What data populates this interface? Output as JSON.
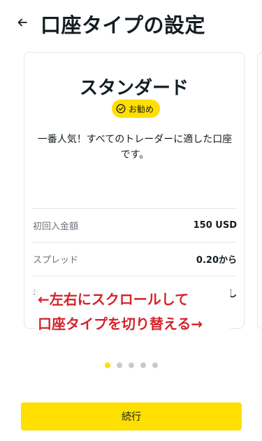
{
  "header": {
    "back_icon": "arrow-left-icon",
    "title": "口座タイプの設定"
  },
  "card": {
    "title": "スタンダード",
    "badge": {
      "icon": "check-circle-icon",
      "label": "お勧め",
      "color": "#ffde02"
    },
    "description": "一番人気！すべてのトレーダーに適した口座です。",
    "specs": [
      {
        "label": "初回入金額",
        "value": "150 USD"
      },
      {
        "label": "スプレッド",
        "value": "0.20から"
      },
      {
        "label": "手",
        "value": "し"
      }
    ]
  },
  "overlay": {
    "line1": "←左右にスクロールして",
    "line2": "口座タイプを切り替える→",
    "color": "#d4232b"
  },
  "pagination": {
    "total": 5,
    "active": 1
  },
  "continue_button": {
    "label": "続行",
    "color": "#ffde02"
  }
}
